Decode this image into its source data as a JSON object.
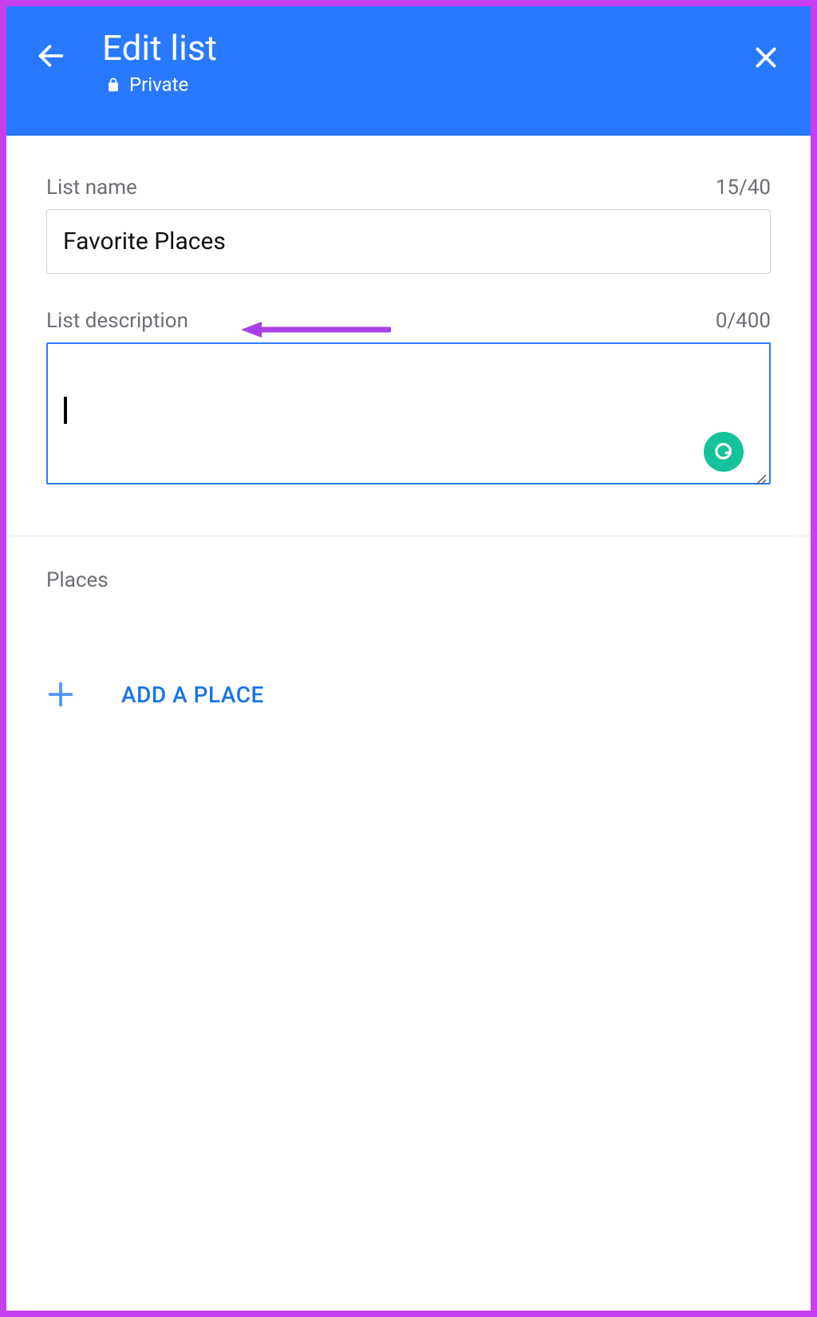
{
  "header": {
    "title": "Edit list",
    "privacy_label": "Private"
  },
  "list_name": {
    "label": "List name",
    "counter": "15/40",
    "value": "Favorite Places"
  },
  "list_description": {
    "label": "List description",
    "counter": "0/400",
    "value": ""
  },
  "places": {
    "section_label": "Places",
    "add_label": "ADD A PLACE"
  }
}
